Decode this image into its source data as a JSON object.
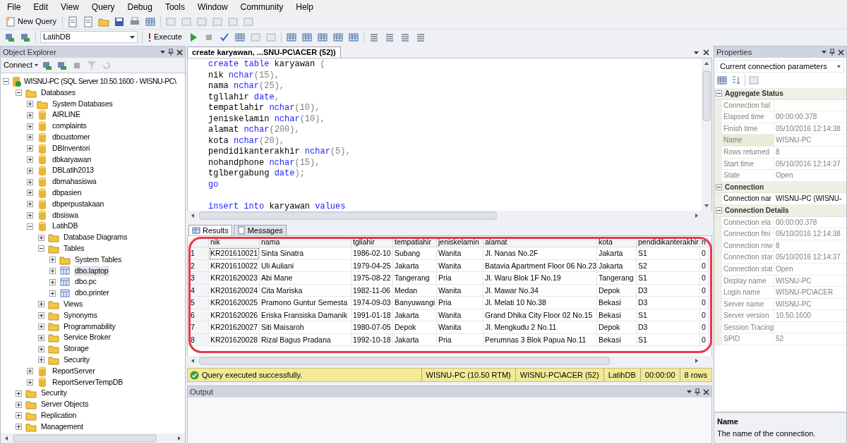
{
  "menu": [
    "File",
    "Edit",
    "View",
    "Query",
    "Debug",
    "Tools",
    "Window",
    "Community",
    "Help"
  ],
  "toolbar": {
    "new_query": "New Query",
    "database": "LatihDB",
    "execute": "Execute"
  },
  "object_explorer": {
    "title": "Object Explorer",
    "connect": "Connect",
    "tree": [
      {
        "label": "WISNU-PC (SQL Server 10.50.1600 - WISNU-PC\\",
        "kind": "server",
        "expanded": true,
        "selected": false,
        "children": [
          {
            "label": "Databases",
            "kind": "folder",
            "expanded": true,
            "selected": false,
            "children": [
              {
                "label": "System Databases",
                "kind": "folder",
                "expanded": false,
                "selected": false
              },
              {
                "label": "AIRLINE",
                "kind": "database",
                "expanded": false,
                "selected": false
              },
              {
                "label": "complaints",
                "kind": "database",
                "expanded": false,
                "selected": false
              },
              {
                "label": "dbcustomer",
                "kind": "database",
                "expanded": false,
                "selected": false
              },
              {
                "label": "DBInventori",
                "kind": "database",
                "expanded": false,
                "selected": false
              },
              {
                "label": "dbkaryawan",
                "kind": "database",
                "expanded": false,
                "selected": false
              },
              {
                "label": "DBLatih2013",
                "kind": "database",
                "expanded": false,
                "selected": false
              },
              {
                "label": "dbmahasiswa",
                "kind": "database",
                "expanded": false,
                "selected": false
              },
              {
                "label": "dbpasien",
                "kind": "database",
                "expanded": false,
                "selected": false
              },
              {
                "label": "dbperpustakaan",
                "kind": "database",
                "expanded": false,
                "selected": false
              },
              {
                "label": "dbsiswa",
                "kind": "database",
                "expanded": false,
                "selected": false
              },
              {
                "label": "LatihDB",
                "kind": "database",
                "expanded": true,
                "selected": false,
                "children": [
                  {
                    "label": "Database Diagrams",
                    "kind": "folder",
                    "expanded": false,
                    "selected": false
                  },
                  {
                    "label": "Tables",
                    "kind": "folder",
                    "expanded": true,
                    "selected": false,
                    "children": [
                      {
                        "label": "System Tables",
                        "kind": "folder",
                        "expanded": false,
                        "selected": false
                      },
                      {
                        "label": "dbo.laptop",
                        "kind": "table",
                        "expanded": false,
                        "selected": true
                      },
                      {
                        "label": "dbo.pc",
                        "kind": "table",
                        "expanded": false,
                        "selected": false
                      },
                      {
                        "label": "dbo.printer",
                        "kind": "table",
                        "expanded": false,
                        "selected": false
                      }
                    ]
                  },
                  {
                    "label": "Views",
                    "kind": "folder",
                    "expanded": false,
                    "selected": false
                  },
                  {
                    "label": "Synonyms",
                    "kind": "folder",
                    "expanded": false,
                    "selected": false
                  },
                  {
                    "label": "Programmability",
                    "kind": "folder",
                    "expanded": false,
                    "selected": false
                  },
                  {
                    "label": "Service Broker",
                    "kind": "folder",
                    "expanded": false,
                    "selected": false
                  },
                  {
                    "label": "Storage",
                    "kind": "folder",
                    "expanded": false,
                    "selected": false
                  },
                  {
                    "label": "Security",
                    "kind": "folder",
                    "expanded": false,
                    "selected": false
                  }
                ]
              },
              {
                "label": "ReportServer",
                "kind": "database",
                "expanded": false,
                "selected": false
              },
              {
                "label": "ReportServerTempDB",
                "kind": "database",
                "expanded": false,
                "selected": false
              }
            ]
          },
          {
            "label": "Security",
            "kind": "folder",
            "expanded": false,
            "selected": false
          },
          {
            "label": "Server Objects",
            "kind": "folder",
            "expanded": false,
            "selected": false
          },
          {
            "label": "Replication",
            "kind": "folder",
            "expanded": false,
            "selected": false
          },
          {
            "label": "Management",
            "kind": "folder",
            "expanded": false,
            "selected": false
          }
        ]
      }
    ]
  },
  "editor": {
    "tab": "create karyawan, ...SNU-PC\\ACER (52))",
    "lines": [
      {
        "tokens": [
          {
            "text": "create table",
            "kind": "keyword"
          },
          {
            "text": " karyawan ",
            "kind": "plain"
          },
          {
            "text": "(",
            "kind": "punct"
          }
        ]
      },
      {
        "tokens": [
          {
            "text": "nik ",
            "kind": "plain"
          },
          {
            "text": "nchar",
            "kind": "keyword"
          },
          {
            "text": "(15),",
            "kind": "punct"
          }
        ]
      },
      {
        "tokens": [
          {
            "text": "nama ",
            "kind": "plain"
          },
          {
            "text": "nchar",
            "kind": "keyword"
          },
          {
            "text": "(25),",
            "kind": "punct"
          }
        ]
      },
      {
        "tokens": [
          {
            "text": "tgllahir ",
            "kind": "plain"
          },
          {
            "text": "date",
            "kind": "keyword"
          },
          {
            "text": ",",
            "kind": "punct"
          }
        ]
      },
      {
        "tokens": [
          {
            "text": "tempatlahir ",
            "kind": "plain"
          },
          {
            "text": "nchar",
            "kind": "keyword"
          },
          {
            "text": "(10),",
            "kind": "punct"
          }
        ]
      },
      {
        "tokens": [
          {
            "text": "jeniskelamin ",
            "kind": "plain"
          },
          {
            "text": "nchar",
            "kind": "keyword"
          },
          {
            "text": "(10),",
            "kind": "punct"
          }
        ]
      },
      {
        "tokens": [
          {
            "text": "alamat ",
            "kind": "plain"
          },
          {
            "text": "nchar",
            "kind": "keyword"
          },
          {
            "text": "(200),",
            "kind": "punct"
          }
        ]
      },
      {
        "tokens": [
          {
            "text": "kota ",
            "kind": "plain"
          },
          {
            "text": "nchar",
            "kind": "keyword"
          },
          {
            "text": "(20),",
            "kind": "punct"
          }
        ]
      },
      {
        "tokens": [
          {
            "text": "pendidikanterakhir ",
            "kind": "plain"
          },
          {
            "text": "nchar",
            "kind": "keyword"
          },
          {
            "text": "(5),",
            "kind": "punct"
          }
        ]
      },
      {
        "tokens": [
          {
            "text": "nohandphone ",
            "kind": "plain"
          },
          {
            "text": "nchar",
            "kind": "keyword"
          },
          {
            "text": "(15),",
            "kind": "punct"
          }
        ]
      },
      {
        "tokens": [
          {
            "text": "tglbergabung ",
            "kind": "plain"
          },
          {
            "text": "date",
            "kind": "keyword"
          },
          {
            "text": ");",
            "kind": "punct"
          }
        ]
      },
      {
        "tokens": [
          {
            "text": "go",
            "kind": "keyword"
          }
        ]
      },
      {
        "blank_before": true,
        "tokens": [
          {
            "text": "insert into",
            "kind": "keyword"
          },
          {
            "text": " karyawan ",
            "kind": "plain"
          },
          {
            "text": "values",
            "kind": "keyword"
          }
        ]
      }
    ]
  },
  "results": {
    "tabs": [
      {
        "label": "Results",
        "selected": true
      },
      {
        "label": "Messages",
        "selected": false
      }
    ],
    "columns": [
      "nik",
      "nama",
      "tgllahir",
      "tempatlahir",
      "jeniskelamin",
      "alamat",
      "kota",
      "pendidikanterakhir",
      "n"
    ],
    "rows": [
      {
        "number": "1",
        "cells": [
          "KR201610021",
          "Sinta Sinatra",
          "1986-02-10",
          "Subang",
          "Wanita",
          "Jl. Nanas No.2F",
          "Jakarta",
          "S1",
          "0"
        ],
        "selected": false
      },
      {
        "number": "2",
        "cells": [
          "KR201610022",
          "Uli Auliani",
          "1979-04-25",
          "Jakarta",
          "Wanita",
          "Batavia Apartment Floor 06 No.23",
          "Jakarta",
          "S2",
          "0"
        ],
        "selected": false
      },
      {
        "number": "3",
        "cells": [
          "KR201620023",
          "Abi Mane",
          "1975-08-22",
          "Tangerang",
          "Pria",
          "Jl. Waru Blok 1F No.19",
          "Tangerang",
          "S1",
          "0"
        ],
        "selected": false
      },
      {
        "number": "4",
        "cells": [
          "KR201620024",
          "Cita Mariska",
          "1982-11-06",
          "Medan",
          "Wanita",
          "Jl. Mawar No.34",
          "Depok",
          "D3",
          "0"
        ],
        "selected": false
      },
      {
        "number": "5",
        "cells": [
          "KR201620025",
          "Pramono Guntur Semesta",
          "1974-09-03",
          "Banyuwangi",
          "Pria",
          "Jl. Melati 10 No.38",
          "Bekasi",
          "D3",
          "0"
        ],
        "selected": false
      },
      {
        "number": "6",
        "cells": [
          "KR201620026",
          "Eriska Fransiska Damanik",
          "1991-01-18",
          "Jakarta",
          "Wanita",
          "Grand Dhika City Floor 02 No.15",
          "Bekasi",
          "S1",
          "0"
        ],
        "selected": false
      },
      {
        "number": "7",
        "cells": [
          "KR201620027",
          "Siti Maisaroh",
          "1980-07-05",
          "Depok",
          "Wanita",
          "Jl. Mengkudu 2 No.11",
          "Depok",
          "D3",
          "0"
        ],
        "selected": false
      },
      {
        "number": "8",
        "cells": [
          "KR201620028",
          "Rizal Bagus Pradana",
          "1992-10-18",
          "Jakarta",
          "Pria",
          "Perumnas 3 Blok Papua No.11",
          "Bekasi",
          "S1",
          "0"
        ],
        "selected": false
      }
    ]
  },
  "status_bar": {
    "message": "Query executed successfully.",
    "segments": [
      "WISNU-PC (10.50 RTM)",
      "WISNU-PC\\ACER (52)",
      "LatihDB",
      "00:00:00",
      "8 rows"
    ]
  },
  "output": {
    "title": "Output"
  },
  "properties": {
    "title": "Properties",
    "object": "Current connection parameters",
    "categories": [
      {
        "name": "Aggregate Status",
        "expanded": true,
        "rows": [
          {
            "name": "Connection fail",
            "value": "",
            "selected": false,
            "readonly": true
          },
          {
            "name": "Elapsed time",
            "value": "00:00:00.378",
            "selected": false,
            "readonly": true
          },
          {
            "name": "Finish time",
            "value": "05/10/2016 12:14:38",
            "selected": false,
            "readonly": true
          },
          {
            "name": "Name",
            "value": "WISNU-PC",
            "selected": true,
            "readonly": true
          },
          {
            "name": "Rows returned",
            "value": "8",
            "selected": false,
            "readonly": true
          },
          {
            "name": "Start time",
            "value": "05/10/2016 12:14:37",
            "selected": false,
            "readonly": true
          },
          {
            "name": "State",
            "value": "Open",
            "selected": false,
            "readonly": true
          }
        ]
      },
      {
        "name": "Connection",
        "expanded": true,
        "rows": [
          {
            "name": "Connection nar",
            "value": "WISNU-PC (WISNU-",
            "selected": false,
            "readonly": false
          }
        ]
      },
      {
        "name": "Connection Details",
        "expanded": true,
        "rows": [
          {
            "name": "Connection ela",
            "value": "00:00:00.378",
            "selected": false,
            "readonly": true
          },
          {
            "name": "Connection fini",
            "value": "05/10/2016 12:14:38",
            "selected": false,
            "readonly": true
          },
          {
            "name": "Connection row",
            "value": "8",
            "selected": false,
            "readonly": true
          },
          {
            "name": "Connection star",
            "value": "05/10/2016 12:14:37",
            "selected": false,
            "readonly": true
          },
          {
            "name": "Connection stat",
            "value": "Open",
            "selected": false,
            "readonly": true
          },
          {
            "name": "Display name",
            "value": "WISNU-PC",
            "selected": false,
            "readonly": true
          },
          {
            "name": "Login name",
            "value": "WISNU-PC\\ACER",
            "selected": false,
            "readonly": true
          },
          {
            "name": "Server name",
            "value": "WISNU-PC",
            "selected": false,
            "readonly": true
          },
          {
            "name": "Server version",
            "value": "10.50.1600",
            "selected": false,
            "readonly": true
          },
          {
            "name": "Session Tracing",
            "value": "",
            "selected": false,
            "readonly": true
          },
          {
            "name": "SPID",
            "value": "52",
            "selected": false,
            "readonly": true
          }
        ]
      }
    ],
    "description": {
      "title": "Name",
      "text": "The name of the connection."
    }
  }
}
